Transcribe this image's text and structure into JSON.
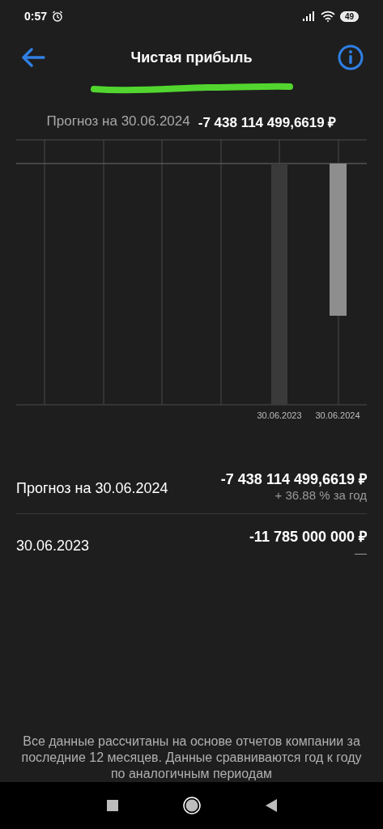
{
  "status_bar": {
    "time": "0:57",
    "battery": "49"
  },
  "header": {
    "title": "Чистая прибыль"
  },
  "chart": {
    "caption": "Прогноз на 30.06.2024",
    "value": "-7 438 114 499,6619 ₽",
    "x_labels": [
      "30.06.2023",
      "30.06.2024"
    ]
  },
  "rows": [
    {
      "label": "Прогноз на 30.06.2024",
      "value": "-7 438 114 499,6619 ₽",
      "change": "+ 36.88 % за год"
    },
    {
      "label": "30.06.2023",
      "value": "-11 785 000 000 ₽",
      "change": "—"
    }
  ],
  "footnote": "Все данные рассчитаны на основе отчетов компании за последние 12 месяцев. Данные сравниваются год к году по аналогичным периодам"
}
